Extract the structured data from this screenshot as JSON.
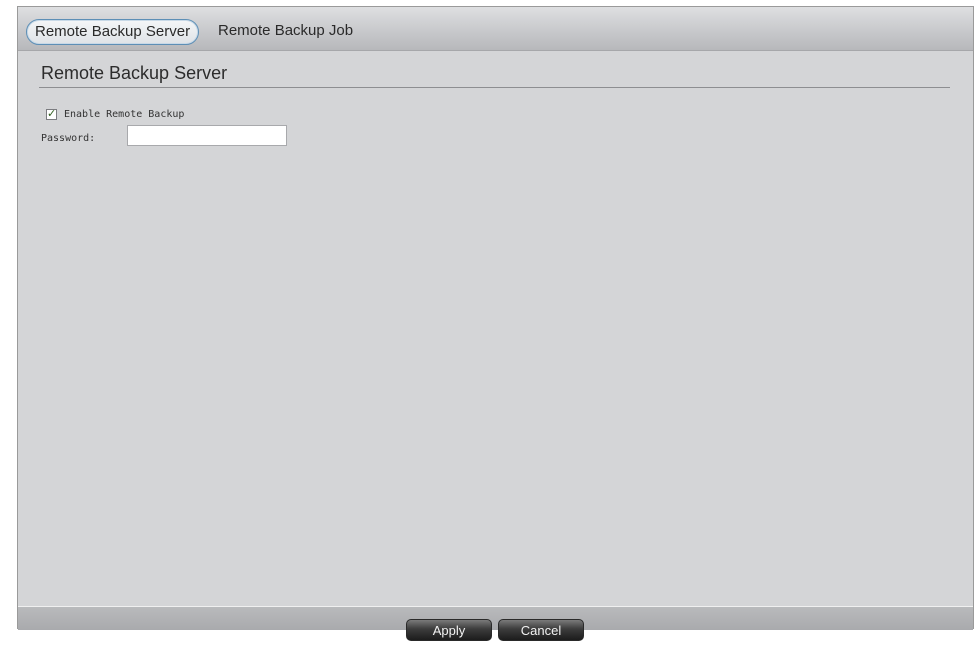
{
  "tabs": {
    "active": "Remote Backup Server",
    "inactive": "Remote Backup Job"
  },
  "section": {
    "title": "Remote Backup Server"
  },
  "enable": {
    "label": "Enable Remote Backup",
    "checked": true,
    "mark": "✓"
  },
  "password": {
    "label": "Password:",
    "value": ""
  },
  "footer": {
    "apply_label": "Apply",
    "cancel_label": "Cancel"
  }
}
